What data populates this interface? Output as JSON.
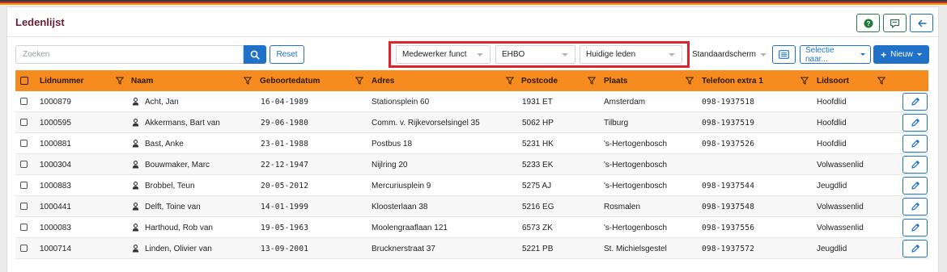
{
  "page": {
    "title": "Ledenlijst"
  },
  "toolbar": {
    "search_placeholder": "Zoeken",
    "reset_label": "Reset",
    "filters": [
      {
        "name": "filter-medewerker-functies",
        "value": "Medewerker functies"
      },
      {
        "name": "filter-ehbo",
        "value": "EHBO"
      },
      {
        "name": "filter-status",
        "value": "Huidige leden"
      }
    ],
    "view_select": "Standaardscherm",
    "selectie_label": "Selectie naar...",
    "nieuw_label": "Nieuw"
  },
  "table": {
    "columns": [
      "Lidnummer",
      "Naam",
      "Geboortedatum",
      "Adres",
      "Postcode",
      "Plaats",
      "Telefoon extra 1",
      "Lidsoort"
    ],
    "rows": [
      {
        "lidnummer": "1000879",
        "naam": "Acht, Jan",
        "geboortedatum": "16-04-1989",
        "adres": "Stationsplein 60",
        "postcode": "1931 ET",
        "plaats": "Amsterdam",
        "telefoon": "098-1937518",
        "lidsoort": "Hoofdlid"
      },
      {
        "lidnummer": "1000595",
        "naam": "Akkermans, Bart van",
        "geboortedatum": "29-06-1980",
        "adres": "Comm. v. Rijkevorselsingel 35",
        "postcode": "5062 HP",
        "plaats": "Tilburg",
        "telefoon": "098-1937519",
        "lidsoort": "Hoofdlid"
      },
      {
        "lidnummer": "1000881",
        "naam": "Bast, Anke",
        "geboortedatum": "23-01-1988",
        "adres": "Postbus 18",
        "postcode": "5231 HK",
        "plaats": "'s-Hertogenbosch",
        "telefoon": "098-1937526",
        "lidsoort": "Hoofdlid"
      },
      {
        "lidnummer": "1000304",
        "naam": "Bouwmaker, Marc",
        "geboortedatum": "22-12-1947",
        "adres": "Nijlring 20",
        "postcode": "5233 EK",
        "plaats": "'s-Hertogenbosch",
        "telefoon": "",
        "lidsoort": "Volwassenlid"
      },
      {
        "lidnummer": "1000883",
        "naam": "Brobbel, Teun",
        "geboortedatum": "20-05-2012",
        "adres": "Mercuriusplein 9",
        "postcode": "5275 AJ",
        "plaats": "'s-Hertogenbosch",
        "telefoon": "098-1937544",
        "lidsoort": "Jeugdlid"
      },
      {
        "lidnummer": "1000441",
        "naam": "Delft, Toine van",
        "geboortedatum": "14-01-1999",
        "adres": "Kloosterlaan 38",
        "postcode": "5216 EG",
        "plaats": "Rosmalen",
        "telefoon": "098-1937548",
        "lidsoort": "Volwassenlid"
      },
      {
        "lidnummer": "1000083",
        "naam": "Harthoud, Rob van",
        "geboortedatum": "19-05-1963",
        "adres": "Moolengraaflaan 121",
        "postcode": "6573 ZK",
        "plaats": "'s-Hertogenbosch",
        "telefoon": "098-1937556",
        "lidsoort": "Volwassenlid"
      },
      {
        "lidnummer": "1000714",
        "naam": "Linden, Olivier van",
        "geboortedatum": "13-09-2001",
        "adres": "Brucknerstraat 37",
        "postcode": "5221 PB",
        "plaats": "St. Michielsgestel",
        "telefoon": "098-1937572",
        "lidsoort": "Jeugdlid"
      }
    ]
  },
  "colors": {
    "accent": "#1f72c8",
    "header": "#f68b1f",
    "title": "#6b1f33",
    "highlight": "#e0222c"
  },
  "icons": {
    "help": "question-circle-icon",
    "message": "chat-icon",
    "back": "arrow-left-icon",
    "search": "search-icon",
    "list": "list-view-icon",
    "filter": "filter-icon",
    "person": "person-icon",
    "edit": "pencil-icon"
  }
}
